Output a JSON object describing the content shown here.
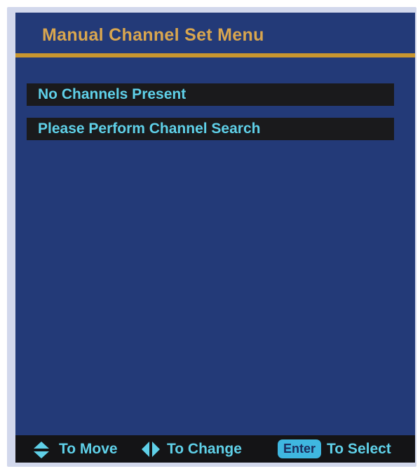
{
  "menu": {
    "title": "Manual Channel Set  Menu"
  },
  "messages": [
    "No Channels Present",
    "Please Perform Channel Search"
  ],
  "footer": {
    "move_label": "To Move",
    "change_label": "To Change",
    "enter_key": "Enter",
    "select_label": "To Select"
  },
  "colors": {
    "background": "#233a78",
    "title": "#d9a64f",
    "accent_rule": "#c9962f",
    "text": "#5fd0e8",
    "row_background": "#1a1a1c",
    "enter_key": "#3fb7e0"
  },
  "icons": {
    "move": "up-down-arrows-icon",
    "change": "left-right-arrows-icon"
  }
}
